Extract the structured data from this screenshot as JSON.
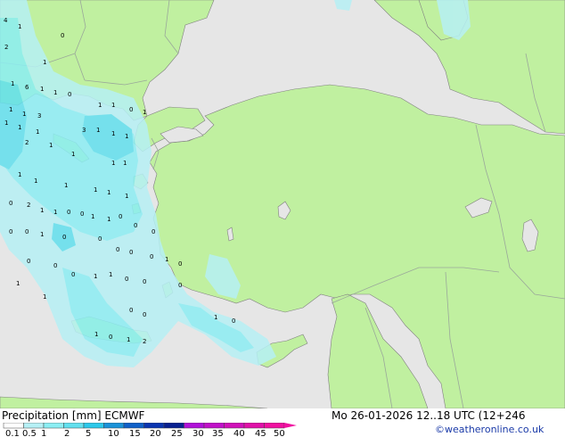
{
  "map": {
    "sea_color": "#e6e6e6",
    "land_color": "#c0f0a0",
    "border_color": "#9aa89a",
    "coast_color": "#808080",
    "point_values": [
      "4",
      "1",
      "0",
      "2",
      "1",
      "1",
      "6",
      "1",
      "1",
      "0",
      "1",
      "1",
      "3",
      "1",
      "1",
      "0",
      "1",
      "1",
      "1",
      "3",
      "1",
      "1",
      "1",
      "2",
      "1",
      "1",
      "1",
      "1",
      "1",
      "1",
      "1",
      "1",
      "1",
      "1",
      "0",
      "2",
      "1",
      "1",
      "0",
      "0",
      "1",
      "1",
      "0",
      "0",
      "0",
      "0",
      "0",
      "1",
      "0",
      "0",
      "0",
      "0",
      "0",
      "1",
      "0",
      "0",
      "0",
      "0",
      "1",
      "1",
      "0",
      "0",
      "0",
      "1",
      "1",
      "0",
      "0",
      "1",
      "0",
      "1",
      "0",
      "1",
      "2",
      "1"
    ]
  },
  "footer": {
    "title": "Precipitation [mm]  ECMWF",
    "datetime": "Mo 26-01-2026 12..18 UTC (12+246",
    "credit": "©weatheronline.co.uk"
  },
  "legend": {
    "labels": [
      "0.1",
      "0.5",
      "1",
      "2",
      "5",
      "10",
      "15",
      "20",
      "25",
      "30",
      "35",
      "40",
      "45",
      "50"
    ],
    "colors": [
      "#ffffff",
      "#b6f0f5",
      "#8ceef3",
      "#62e0ee",
      "#2cc8ea",
      "#1a92d8",
      "#1060c8",
      "#0a34b0",
      "#082090",
      "#b010d8",
      "#c010c8",
      "#d010b8",
      "#e010a8",
      "#f010a0"
    ]
  }
}
